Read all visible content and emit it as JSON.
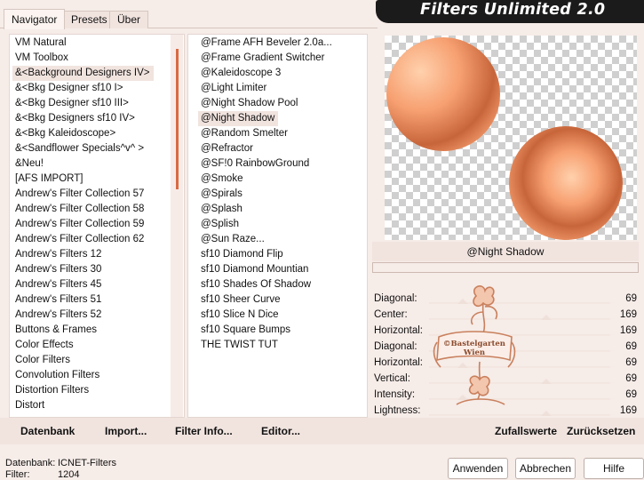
{
  "header": {
    "title": "Filters Unlimited 2.0"
  },
  "tabs": [
    {
      "label": "Navigator",
      "active": true
    },
    {
      "label": "Presets",
      "active": false
    },
    {
      "label": "Über",
      "active": false
    }
  ],
  "categories": {
    "items": [
      "VM Natural",
      "VM Toolbox",
      "&<Background Designers IV>",
      "&<Bkg Designer sf10 I>",
      "&<Bkg Designer sf10 III>",
      "&<Bkg Designers sf10 IV>",
      "&<Bkg Kaleidoscope>",
      "&<Sandflower Specials^v^ >",
      "&Neu!",
      "[AFS IMPORT]",
      "Andrew's Filter Collection 57",
      "Andrew's Filter Collection 58",
      "Andrew's Filter Collection 59",
      "Andrew's Filter Collection 62",
      "Andrew's Filters 12",
      "Andrew's Filters 30",
      "Andrew's Filters 45",
      "Andrew's Filters 51",
      "Andrew's Filters 52",
      "Buttons & Frames",
      "Color Effects",
      "Color Filters",
      "Convolution Filters",
      "Distortion Filters",
      "Distort"
    ],
    "selected_index": 2
  },
  "filters": {
    "items": [
      "@Frame AFH Beveler 2.0a...",
      "@Frame Gradient Switcher",
      "@Kaleidoscope 3",
      "@Light Limiter",
      "@Night Shadow Pool",
      "@Night Shadow",
      "@Random Smelter",
      "@Refractor",
      "@SF!0 RainbowGround",
      "@Smoke",
      "@Spirals",
      "@Splash",
      "@Splish",
      "@Sun Raze...",
      "sf10 Diamond Flip",
      "sf10 Diamond Mountian",
      "sf10 Shades Of Shadow",
      "sf10 Sheer Curve",
      "sf10 Slice N Dice",
      "sf10 Square Bumps",
      "THE TWIST TUT"
    ],
    "selected_index": 5
  },
  "preview": {
    "filter_name": "@Night Shadow",
    "progress": 0,
    "orb_colors": [
      "#f7a071",
      "#ffd1ad",
      "#c7653a"
    ]
  },
  "parameters": [
    {
      "label": "Diagonal:",
      "value": "69"
    },
    {
      "label": "Center:",
      "value": "169"
    },
    {
      "label": "Horizontal:",
      "value": "169"
    },
    {
      "label": "Diagonal:",
      "value": "69"
    },
    {
      "label": "Horizontal:",
      "value": "69"
    },
    {
      "label": "Vertical:",
      "value": "69"
    },
    {
      "label": "Intensity:",
      "value": "69"
    },
    {
      "label": "Lightness:",
      "value": "169"
    }
  ],
  "watermark": {
    "line1": "©Bastelgarten",
    "line2": "Wien"
  },
  "actions": {
    "database": "Datenbank",
    "import": "Import...",
    "filter_info": "Filter Info...",
    "editor": "Editor...",
    "randomize": "Zufallswerte",
    "reset": "Zurücksetzen"
  },
  "status": {
    "database_label": "Datenbank:",
    "database_value": "ICNET-Filters",
    "filter_label": "Filter:",
    "filter_value": "1204"
  },
  "buttons": {
    "apply": "Anwenden",
    "cancel": "Abbrechen",
    "help": "Hilfe"
  }
}
